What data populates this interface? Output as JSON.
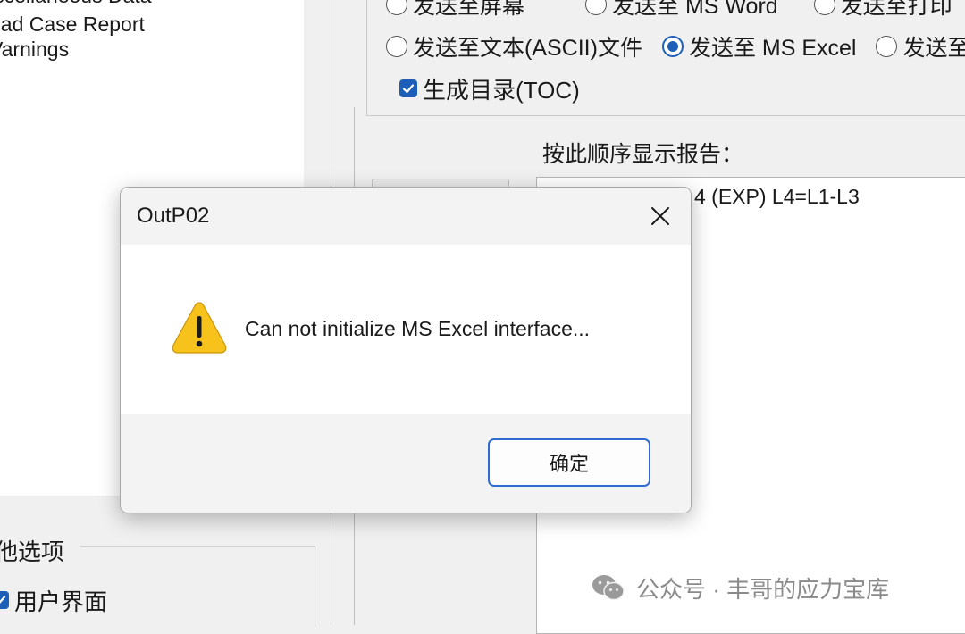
{
  "left_list": {
    "items": [
      "iscellaneous Data",
      "oad Case Report",
      "Varnings"
    ]
  },
  "other_options": {
    "label": "他选项",
    "user_interface_label": "用户界面",
    "user_interface_checked": true
  },
  "output_options": {
    "row1": [
      "发送至屏幕",
      "发送至 MS Word",
      "发送至打印"
    ],
    "row2": [
      "发送至文本(ASCII)文件",
      "发送至 MS Excel",
      "发送至"
    ],
    "selected": "发送至 MS Excel",
    "toc_label": "生成目录(TOC)",
    "toc_checked": true
  },
  "report_order": {
    "label": "按此顺序显示报告：",
    "entries": [
      "4 (EXP) L4=L1-L3"
    ]
  },
  "dialog": {
    "title": "OutP02",
    "message": "Can not initialize MS Excel interface...",
    "ok_label": "确定",
    "icon": "warning-icon"
  },
  "watermark": {
    "text": "公众号 · 丰哥的应力宝库"
  },
  "colors": {
    "accent": "#1c5fb8",
    "ok_border": "#2f6bd0",
    "warning_fill": "#f7c21c",
    "dialog_title_bg": "#f3f3f3"
  }
}
